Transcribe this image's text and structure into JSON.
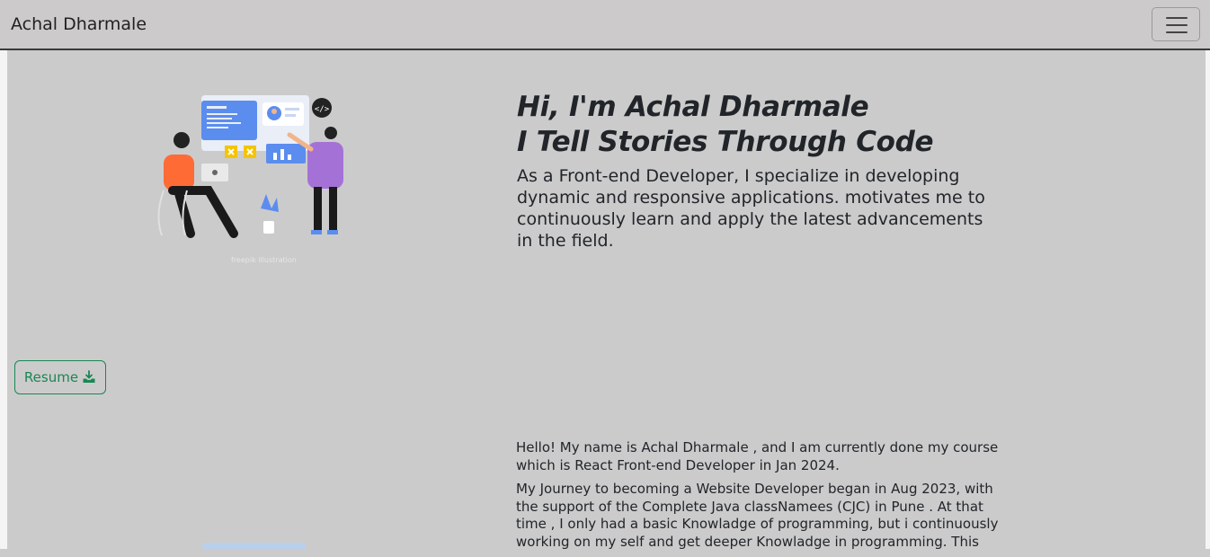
{
  "navbar": {
    "brand": "Achal Dharmale",
    "toggle_icon": "hamburger-menu-icon"
  },
  "hero": {
    "illustration": "developers-collaborating-illustration",
    "title_line1": "Hi, I'm Achal Dharmale",
    "title_line2": "I Tell Stories Through Code",
    "description": "As a Front-end Developer, I specialize in developing dynamic and responsive applications. motivates me to continuously learn and apply the latest advancements in the field."
  },
  "resume": {
    "label": "Resume",
    "icon": "download-icon",
    "color": "#198754"
  },
  "about": {
    "paragraph1": "Hello! My name is Achal Dharmale , and I am currently done my course which is React Front-end Developer in Jan 2024.",
    "paragraph2": "My Journey to becoming a Website Developer began in Aug 2023, with the support of the Complete Java classNamees (CJC) in Pune . At that time , I only had a basic Knowladge of programming, but i continuously working on my self and get deeper Knowladge in programming. This"
  }
}
